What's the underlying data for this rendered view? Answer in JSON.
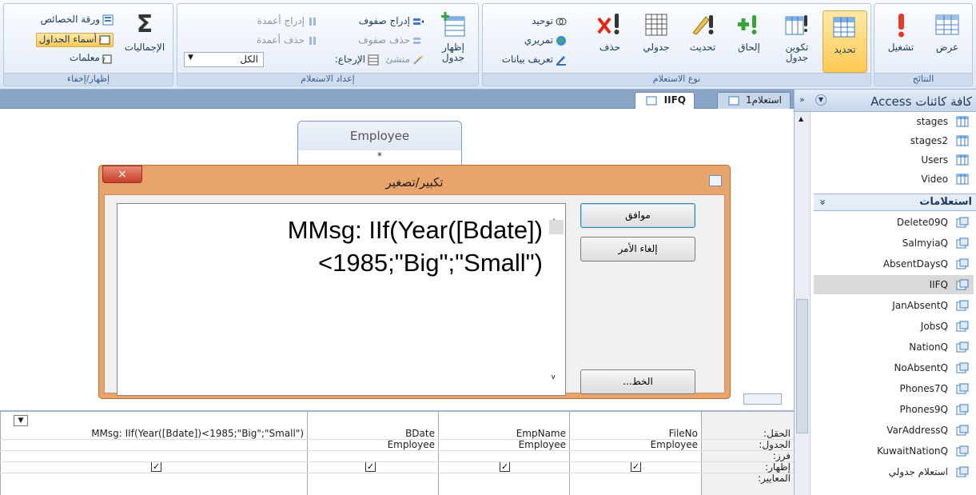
{
  "ribbon": {
    "groups": {
      "results": "النتائج",
      "query_type": "نوع الاستعلام",
      "query_setup": "إعداد الاستعلام",
      "show_hide": "إظهار/إخفاء"
    },
    "buttons": {
      "view": "عرض",
      "run": "تشغيل",
      "select": "تحديد",
      "make_table": "تكوين جدول",
      "append": "إلحاق",
      "update": "تحديث",
      "crosstab": "جدولي",
      "delete": "حذف",
      "union": "توحيد",
      "pass_through": "تمريري",
      "data_definition": "تعريف بيانات",
      "show_table": "إظهار جدول",
      "insert_rows": "إدراج صفوف",
      "delete_rows": "حذف صفوف",
      "builder": "منشئ",
      "insert_columns": "إدراج أعمدة",
      "delete_columns": "حذف أعمدة",
      "return_label": "الإرجاع:",
      "return_value": "الكل",
      "totals": "الإجماليات",
      "property_sheet": "ورقة الخصائص",
      "table_names": "أسماء الجداول",
      "parameters": "معلمات"
    }
  },
  "tabs": [
    {
      "label": "استعلام1"
    },
    {
      "label": "IIFQ"
    }
  ],
  "design": {
    "table_name": "Employee",
    "field_star": "*"
  },
  "zoom_dialog": {
    "title": "تكبير/تصغير",
    "close": "×",
    "expression_line1": "MMsg: IIf(Year([Bdate])",
    "expression_line2": "<1985;\"Big\";\"Small\")",
    "ok": "موافق",
    "cancel": "إلغاء الأمر",
    "font": "الخط..."
  },
  "nav": {
    "header": "كافة كائنات Access",
    "tables": [
      "stages",
      "stages2",
      "Users",
      "Video"
    ],
    "queries_section": "استعلامات",
    "queries": [
      "Delete09Q",
      "SalmyiaQ",
      "AbsentDaysQ",
      "IIFQ",
      "JanAbsentQ",
      "JobsQ",
      "NationQ",
      "NoAbsentQ",
      "Phones7Q",
      "Phones9Q",
      "VarAddressQ",
      "KuwaitNationQ",
      "استعلام جدولي"
    ]
  },
  "grid": {
    "labels": [
      "الحقل:",
      "الجدول:",
      "فرز:",
      "إظهار:",
      "المعايير:"
    ],
    "columns": [
      {
        "field": "FileNo",
        "table": "Employee",
        "show": true
      },
      {
        "field": "EmpName",
        "table": "Employee",
        "show": true
      },
      {
        "field": "BDate",
        "table": "Employee",
        "show": true
      },
      {
        "field": "MMsg: IIf(Year([Bdate])<1985;\"Big\";\"Small\")",
        "table": "",
        "show": true
      }
    ]
  },
  "colors": {
    "dialog_frame": "#e8a46a",
    "ribbon_active": "#ffc953",
    "selection": "#d9d9d9"
  }
}
